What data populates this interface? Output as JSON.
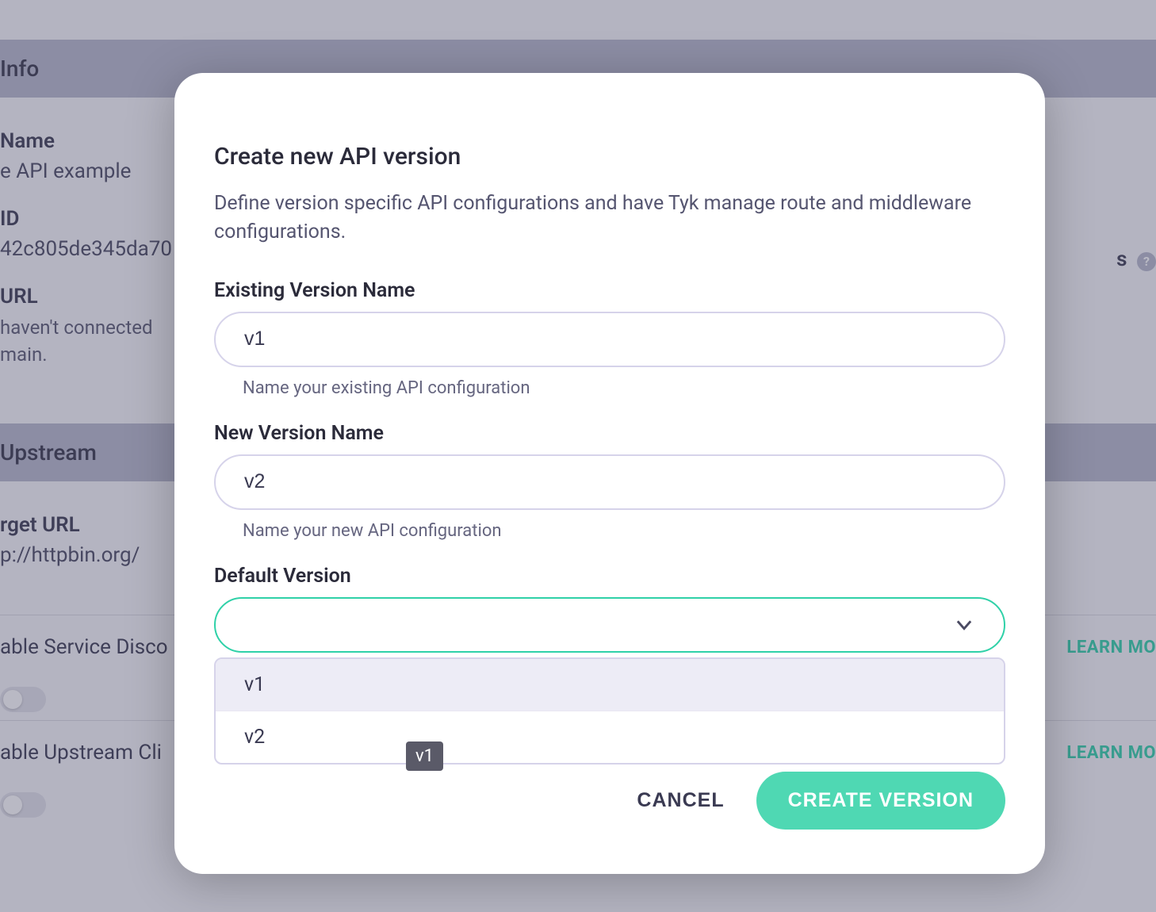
{
  "backdrop": {
    "section_info": "Info",
    "name_label": "Name",
    "name_value": "e API example",
    "id_label": "ID",
    "id_value": "42c805de345da70",
    "url_label": "URL",
    "url_note": "haven't connected\nmain.",
    "right_s_label": "s",
    "section_upstream": "Upstream",
    "target_url_label": "rget URL",
    "target_url_value": "p://httpbin.org/",
    "toggle1_label": "able Service Disco",
    "toggle2_label": "able Upstream Cli",
    "learn_more1": "LEARN MO",
    "learn_more2": "LEARN MO"
  },
  "modal": {
    "title": "Create new API version",
    "description": "Define version specific API configurations and have Tyk manage route and middleware configurations.",
    "existing_label": "Existing Version Name",
    "existing_value": "v1",
    "existing_helper": "Name your existing API configuration",
    "new_label": "New Version Name",
    "new_value": "v2",
    "new_helper": "Name your new API configuration",
    "default_label": "Default Version",
    "default_value": "",
    "options": {
      "0": "v1",
      "1": "v2"
    },
    "cancel": "CANCEL",
    "create": "CREATE VERSION"
  },
  "tooltip": "v1"
}
